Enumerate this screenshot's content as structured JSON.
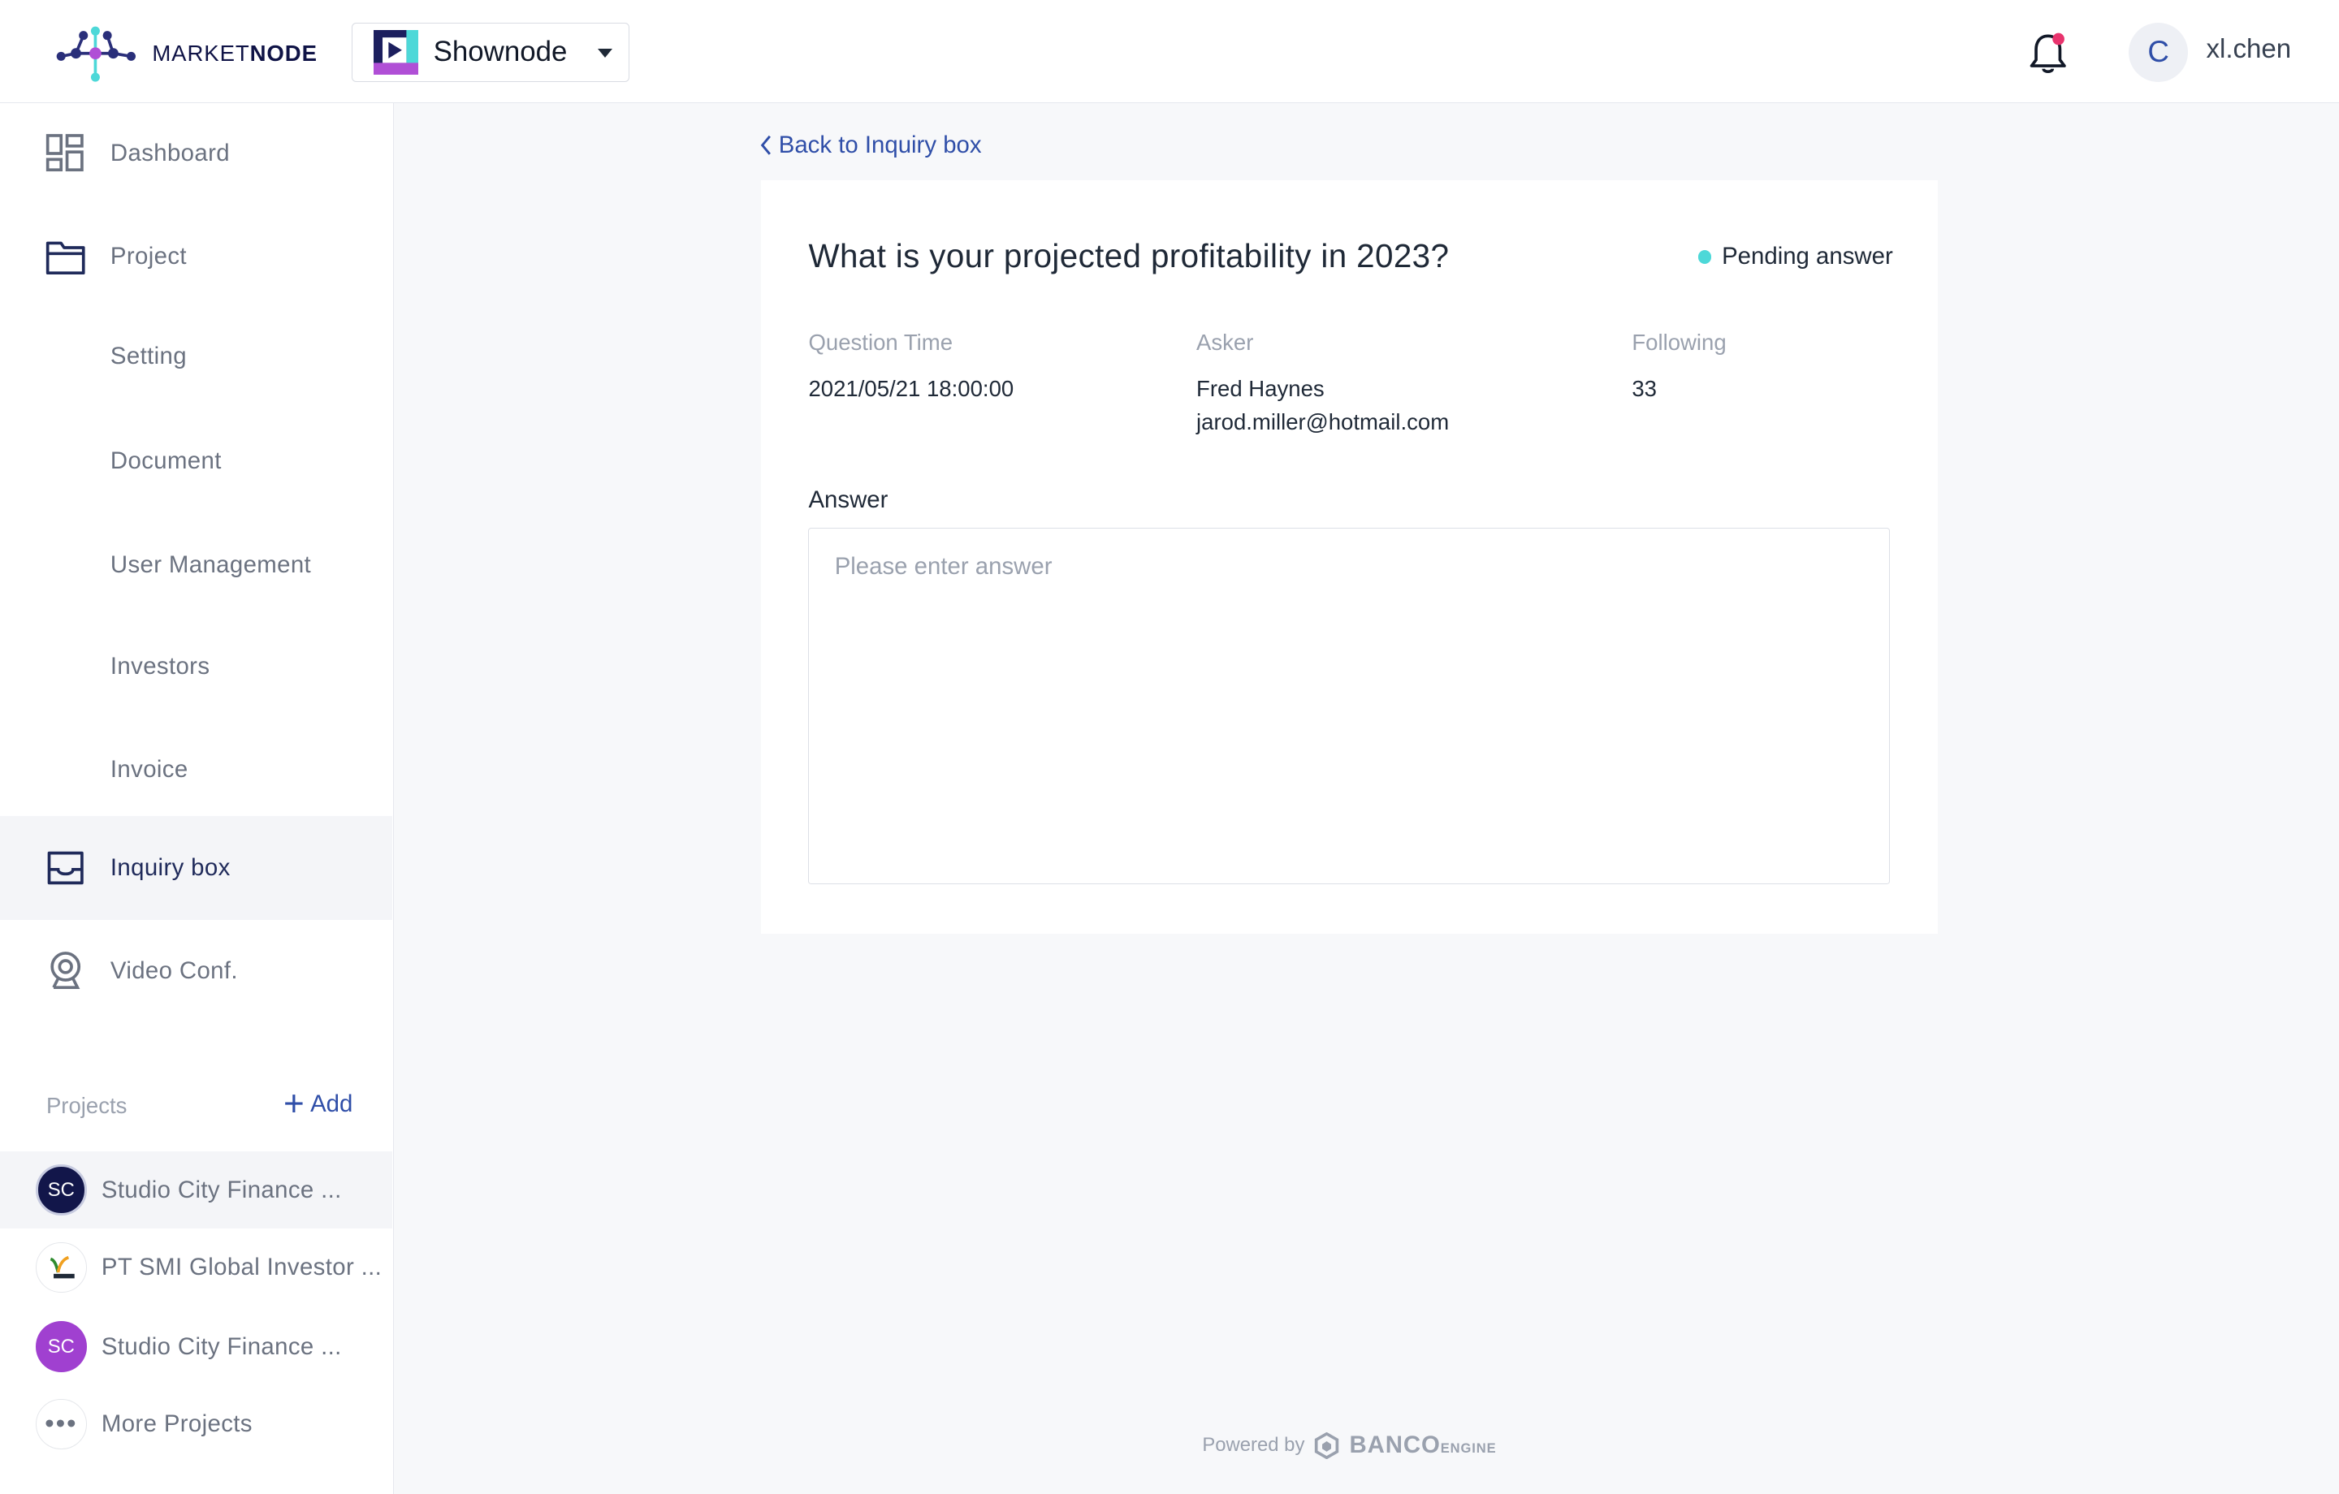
{
  "header": {
    "logo_text_light": "MARKET",
    "logo_text_bold": "NODE",
    "project_selector": "Shownode",
    "username": "xl.chen",
    "user_initial": "C"
  },
  "sidebar": {
    "nav": [
      {
        "label": "Dashboard",
        "icon": "dashboard-icon"
      },
      {
        "label": "Project",
        "icon": "folder-icon"
      },
      {
        "label": "Setting"
      },
      {
        "label": "Document"
      },
      {
        "label": "User Management"
      },
      {
        "label": "Investors"
      },
      {
        "label": "Invoice"
      },
      {
        "label": "Inquiry box",
        "icon": "inbox-icon",
        "active": true
      },
      {
        "label": "Video Conf.",
        "icon": "webcam-icon"
      }
    ],
    "projects_heading": "Projects",
    "add_label": "Add",
    "projects": [
      {
        "initials": "SC",
        "name": "Studio City Finance ...",
        "color": "#12164a"
      },
      {
        "initials": "",
        "name": "PT SMI Global Investor ...",
        "color": "#ffffff"
      },
      {
        "initials": "SC",
        "name": "Studio City Finance ...",
        "color": "#a040d0"
      }
    ],
    "more_projects": "More Projects"
  },
  "main": {
    "back_link": "Back to Inquiry box",
    "question": "What is your projected profitability in 2023?",
    "status": "Pending answer",
    "meta": {
      "time_label": "Question Time",
      "time_value": "2021/05/21 18:00:00",
      "asker_label": "Asker",
      "asker_name": "Fred Haynes",
      "asker_email": "jarod.miller@hotmail.com",
      "following_label": "Following",
      "following_value": "33"
    },
    "answer_label": "Answer",
    "answer_placeholder": "Please enter answer"
  },
  "footer": {
    "powered_by": "Powered by",
    "brand": "BANCO",
    "brand_suffix": "ENGINE"
  },
  "colors": {
    "accent": "#2f4ea8",
    "navy": "#0f1346",
    "status_dot": "#4dd8d8",
    "notification_dot": "#e8336d"
  }
}
